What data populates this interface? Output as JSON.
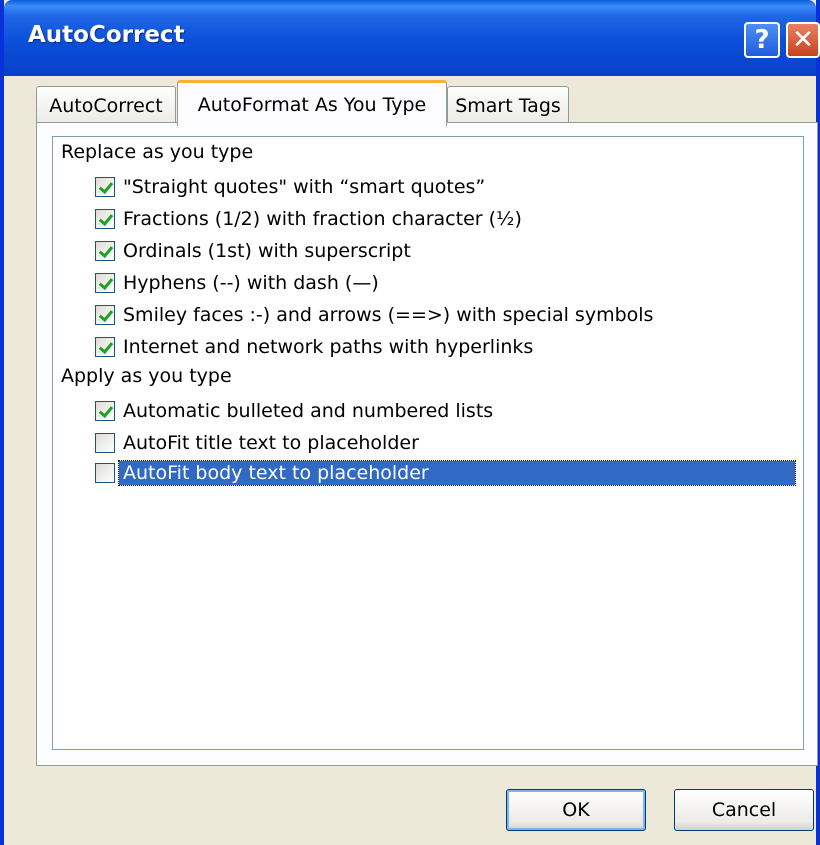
{
  "window": {
    "title": "AutoCorrect",
    "help_glyph": "?",
    "close_glyph": "✕"
  },
  "tabs": [
    {
      "label": "AutoCorrect"
    },
    {
      "label": "AutoFormat As You Type"
    },
    {
      "label": "Smart Tags"
    }
  ],
  "groups": {
    "replace": {
      "label": "Replace as you type",
      "items": [
        {
          "label": "\"Straight quotes\" with “smart quotes”",
          "checked": true
        },
        {
          "label": "Fractions (1/2) with fraction character (½)",
          "checked": true
        },
        {
          "label": "Ordinals (1st) with superscript",
          "checked": true
        },
        {
          "label": "Hyphens (--) with dash (—)",
          "checked": true
        },
        {
          "label": "Smiley faces :-) and arrows (==>) with special symbols",
          "checked": true
        },
        {
          "label": "Internet and network paths with hyperlinks",
          "checked": true
        }
      ]
    },
    "apply": {
      "label": "Apply as you type",
      "items": [
        {
          "label": "Automatic bulleted and numbered lists",
          "checked": true
        },
        {
          "label": "AutoFit title text to placeholder",
          "checked": false
        },
        {
          "label": "AutoFit body text to placeholder",
          "checked": false,
          "selected": true
        }
      ]
    }
  },
  "buttons": {
    "ok": "OK",
    "cancel": "Cancel"
  }
}
